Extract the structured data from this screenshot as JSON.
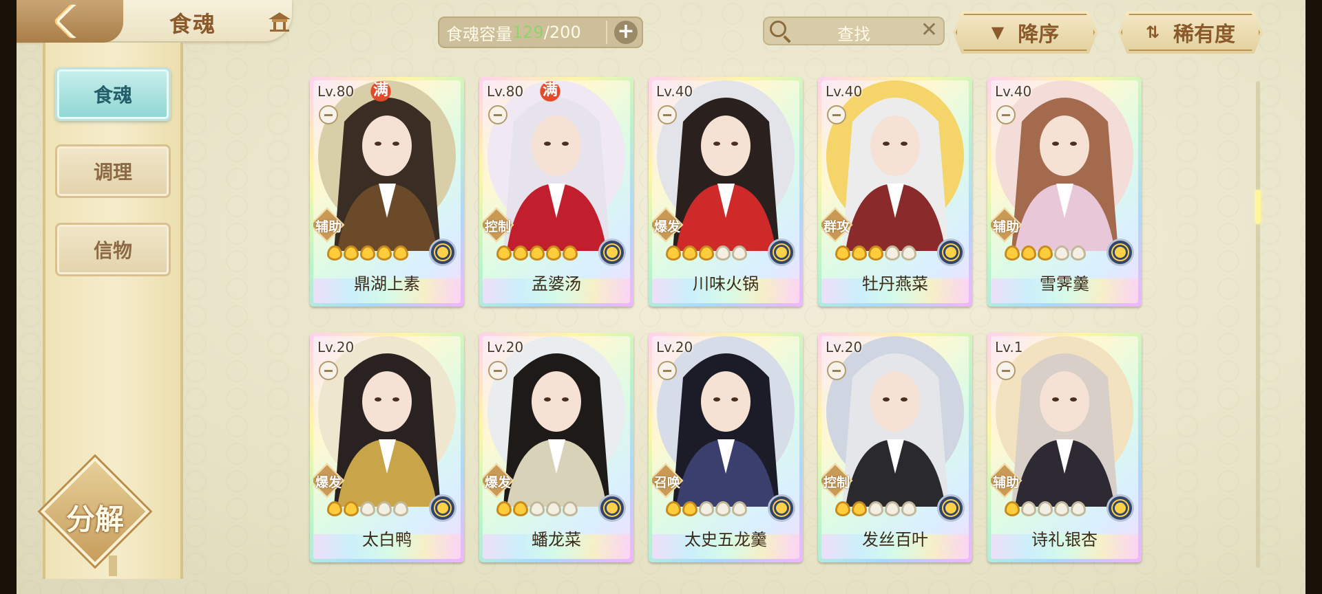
{
  "header": {
    "title": "食魂",
    "capacity": {
      "label": "食魂容量",
      "current": "129",
      "max": "/200",
      "add_symbol": "+"
    },
    "search": {
      "placeholder": "查找",
      "clear_symbol": "✕"
    },
    "sort_order": {
      "label": "降序",
      "icon": "triangle-down-icon"
    },
    "sort_by": {
      "label": "稀有度",
      "icon": "sort-arrows-icon"
    }
  },
  "sidebar": {
    "items": [
      {
        "label": "食魂",
        "active": true
      },
      {
        "label": "调理",
        "active": false
      },
      {
        "label": "信物",
        "active": false
      }
    ],
    "decompose_label": "分解"
  },
  "cards": [
    {
      "level": "Lv.80",
      "maxed": true,
      "maxed_label": "满",
      "role": "辅助",
      "stars": 5,
      "name": "鼎湖上素",
      "art": [
        "#d8cfa8",
        "#3a2e24",
        "#6b4a2a"
      ]
    },
    {
      "level": "Lv.80",
      "maxed": true,
      "maxed_label": "满",
      "role": "控制",
      "stars": 5,
      "name": "孟婆汤",
      "art": [
        "#f0e8f2",
        "#e7e3ec",
        "#c21f2e"
      ]
    },
    {
      "level": "Lv.40",
      "maxed": false,
      "maxed_label": "",
      "role": "爆发",
      "stars": 3,
      "name": "川味火锅",
      "art": [
        "#e2e4ea",
        "#2a211e",
        "#cf2a2a"
      ]
    },
    {
      "level": "Lv.40",
      "maxed": false,
      "maxed_label": "",
      "role": "群攻",
      "stars": 3,
      "name": "牡丹燕菜",
      "art": [
        "#f5d46a",
        "#ececec",
        "#8a2a2a"
      ]
    },
    {
      "level": "Lv.40",
      "maxed": false,
      "maxed_label": "",
      "role": "辅助",
      "stars": 3,
      "name": "雪霁羹",
      "art": [
        "#f4dcd8",
        "#a36a4e",
        "#e8c8d8"
      ]
    },
    {
      "level": "Lv.20",
      "maxed": false,
      "maxed_label": "",
      "role": "爆发",
      "stars": 2,
      "name": "太白鸭",
      "art": [
        "#efe6d0",
        "#2a2220",
        "#c9a54a"
      ]
    },
    {
      "level": "Lv.20",
      "maxed": false,
      "maxed_label": "",
      "role": "爆发",
      "stars": 2,
      "name": "蟠龙菜",
      "art": [
        "#e9edf0",
        "#1e1a18",
        "#d8d2b8"
      ]
    },
    {
      "level": "Lv.20",
      "maxed": false,
      "maxed_label": "",
      "role": "召唤",
      "stars": 2,
      "name": "太史五龙羹",
      "art": [
        "#d6dce8",
        "#1c1c28",
        "#3a3f6e"
      ]
    },
    {
      "level": "Lv.20",
      "maxed": false,
      "maxed_label": "",
      "role": "控制",
      "stars": 2,
      "name": "发丝百叶",
      "art": [
        "#cfd6e2",
        "#e4e6ea",
        "#2a2a2e"
      ]
    },
    {
      "level": "Lv.1",
      "maxed": false,
      "maxed_label": "",
      "role": "辅助",
      "stars": 1,
      "name": "诗礼银杏",
      "art": [
        "#f2e2c0",
        "#d8cfc8",
        "#2e2a34"
      ]
    }
  ],
  "max_stars": 5,
  "scroll_position": 0.24,
  "colors": {
    "accent_active": "#8fd6d3",
    "brown_text": "#8b5a2b",
    "capacity_current": "#8fd46a",
    "star_on": "#ffcd3b"
  }
}
